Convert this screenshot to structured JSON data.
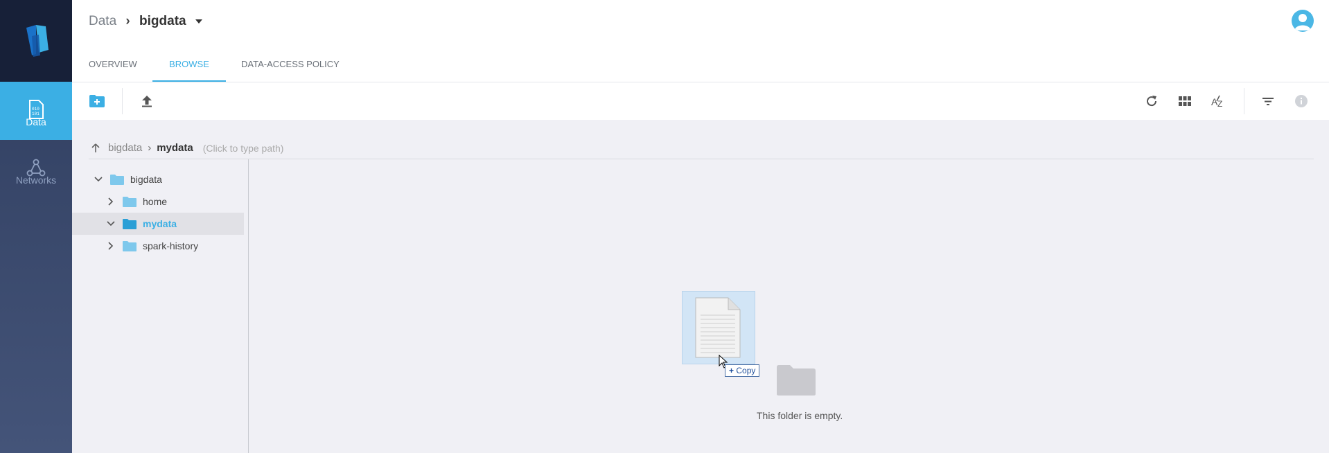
{
  "sidebar": {
    "items": [
      {
        "label": "Data",
        "icon": "binary-file-icon",
        "active": true
      },
      {
        "label": "Networks",
        "icon": "network-nodes-icon",
        "active": false
      }
    ]
  },
  "header": {
    "breadcrumb": {
      "root": "Data",
      "current": "bigdata"
    },
    "tabs": [
      {
        "label": "OVERVIEW",
        "active": false
      },
      {
        "label": "BROWSE",
        "active": true
      },
      {
        "label": "DATA-ACCESS POLICY",
        "active": false
      }
    ]
  },
  "toolbar": {
    "left": [
      "new-folder-icon",
      "upload-icon"
    ],
    "right": [
      "refresh-icon",
      "grid-view-icon",
      "sort-az-icon",
      "filter-icon",
      "info-icon"
    ]
  },
  "path": {
    "root": "bigdata",
    "current": "mydata",
    "hint": "(Click to type path)"
  },
  "tree": {
    "items": [
      {
        "name": "bigdata",
        "expanded": true,
        "selected": false
      },
      {
        "name": "home",
        "expanded": false,
        "selected": false
      },
      {
        "name": "mydata",
        "expanded": true,
        "selected": true
      },
      {
        "name": "spark-history",
        "expanded": false,
        "selected": false
      }
    ]
  },
  "content": {
    "empty_message": "This folder is empty.",
    "drag_tooltip": "Copy"
  },
  "colors": {
    "accent": "#3bafe4",
    "sidebar": "#2f3d5e",
    "logo_bg": "#172038"
  }
}
